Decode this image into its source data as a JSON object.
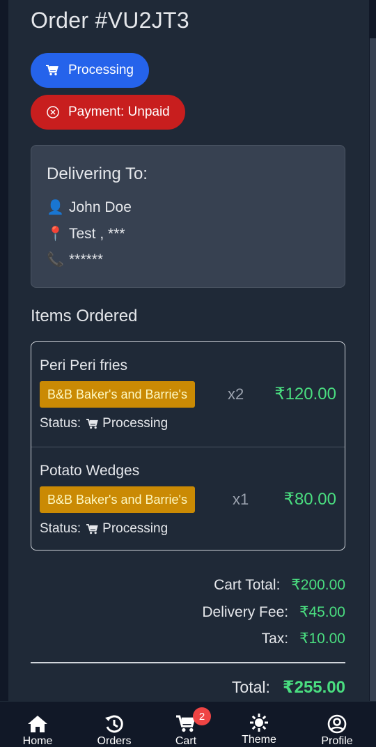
{
  "order": {
    "title": "Order #VU2JT3",
    "status_label": "Processing",
    "payment_label": "Payment: Unpaid"
  },
  "delivery": {
    "heading": "Delivering To:",
    "name": "John Doe",
    "address": "Test , ***",
    "phone": "******",
    "icons": {
      "name": "person-icon",
      "address": "pin-icon",
      "phone": "phone-icon"
    }
  },
  "items_section": {
    "heading": "Items Ordered",
    "items": [
      {
        "name": "Peri Peri fries",
        "vendor": "B&B Baker's and Barrie's",
        "qty": "x2",
        "price": "₹120.00",
        "status_label": "Status:",
        "status": "Processing"
      },
      {
        "name": "Potato Wedges",
        "vendor": "B&B Baker's and Barrie's",
        "qty": "x1",
        "price": "₹80.00",
        "status_label": "Status:",
        "status": "Processing"
      }
    ]
  },
  "totals": {
    "cart_label": "Cart Total:",
    "cart_value": "₹200.00",
    "delivery_label": "Delivery Fee:",
    "delivery_value": "₹45.00",
    "tax_label": "Tax:",
    "tax_value": "₹10.00",
    "total_label": "Total:",
    "total_value": "₹255.00"
  },
  "nav": {
    "items": [
      {
        "label": "Home",
        "icon": "home-icon"
      },
      {
        "label": "Orders",
        "icon": "history-icon"
      },
      {
        "label": "Cart",
        "icon": "cart-icon",
        "badge": "2"
      },
      {
        "label": "Theme",
        "icon": "sun-icon"
      },
      {
        "label": "Profile",
        "icon": "profile-icon"
      }
    ]
  },
  "colors": {
    "processing": "#2563eb",
    "unpaid": "#c81e1e",
    "vendor_tag": "#ca8a04",
    "price": "#4ade80",
    "background": "#1f2937"
  }
}
